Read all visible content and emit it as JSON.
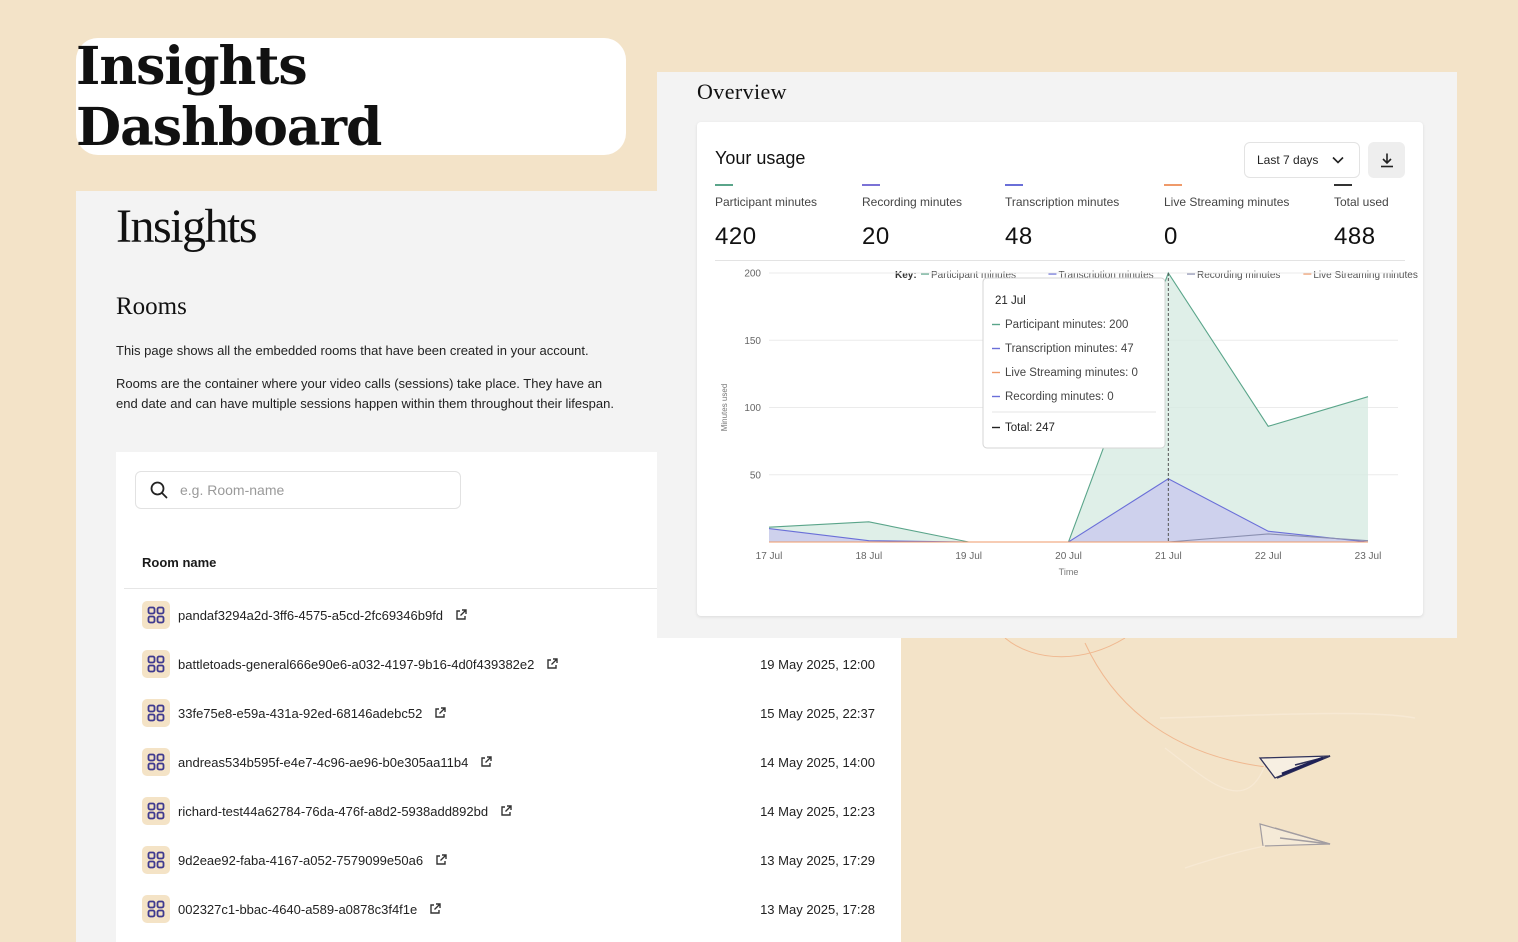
{
  "banner": {
    "title": "Insights Dashboard"
  },
  "rooms_page": {
    "logo": "Insights",
    "heading": "Rooms",
    "description1": "This page shows all the embedded rooms that have been created in your account.",
    "description2": "Rooms are the container where your video calls (sessions) take place. They have an end date and can have multiple sessions happen within them throughout their lifespan.",
    "search": {
      "placeholder": "e.g. Room-name"
    },
    "column_room_name": "Room name",
    "rooms": [
      {
        "name": "pandaf3294a2d-3ff6-4575-a5cd-2fc69346b9fd",
        "date": ""
      },
      {
        "name": "battletoads-general666e90e6-a032-4197-9b16-4d0f439382e2",
        "date": "19 May 2025, 12:00"
      },
      {
        "name": "33fe75e8-e59a-431a-92ed-68146adebc52",
        "date": "15 May 2025, 22:37"
      },
      {
        "name": "andreas534b595f-e4e7-4c96-ae96-b0e305aa11b4",
        "date": "14 May 2025, 14:00"
      },
      {
        "name": "richard-test44a62784-76da-476f-a8d2-5938add892bd",
        "date": "14 May 2025, 12:23"
      },
      {
        "name": "9d2eae92-faba-4167-a052-7579099e50a6",
        "date": "13 May 2025, 17:29"
      },
      {
        "name": "002327c1-bbac-4640-a589-a0878c3f4f1e",
        "date": "13 May 2025, 17:28"
      }
    ]
  },
  "overview": {
    "title": "Overview",
    "usage_title": "Your usage",
    "range_select": "Last 7 days",
    "stats": [
      {
        "label": "Participant minutes",
        "value": "420",
        "color": "#5aa58a"
      },
      {
        "label": "Recording minutes",
        "value": "20",
        "color": "#7b72d6"
      },
      {
        "label": "Transcription minutes",
        "value": "48",
        "color": "#6a6fd8"
      },
      {
        "label": "Live Streaming minutes",
        "value": "0",
        "color": "#ef9a6a"
      },
      {
        "label": "Total used",
        "value": "488",
        "color": "#333333"
      }
    ],
    "tooltip": {
      "date": "21 Jul",
      "lines": [
        "Participant minutes: 200",
        "Transcription minutes: 47",
        "Live Streaming minutes: 0",
        "Recording minutes: 0"
      ],
      "total": "Total: 247"
    }
  },
  "chart_data": {
    "type": "area",
    "key_label": "Key:",
    "x": [
      "17 Jul",
      "18 Jul",
      "19 Jul",
      "20 Jul",
      "21 Jul",
      "22 Jul",
      "23 Jul"
    ],
    "xlabel": "Time",
    "ylabel": "Minutes used",
    "ylim": [
      0,
      200
    ],
    "yticks": [
      50,
      100,
      150,
      200
    ],
    "grid": true,
    "legend": "top-right",
    "series": [
      {
        "name": "Participant minutes",
        "color": "#5aa58a",
        "fill": "#d7ebe2",
        "values": [
          11,
          15,
          0,
          0,
          200,
          86,
          108
        ]
      },
      {
        "name": "Transcription minutes",
        "color": "#6a6fd8",
        "fill": "#c9c9ee",
        "values": [
          10,
          1,
          0,
          0,
          47,
          8,
          0
        ]
      },
      {
        "name": "Recording minutes",
        "color": "#8a8fb0",
        "fill": "none",
        "values": [
          0,
          0,
          0,
          0,
          0,
          6,
          1
        ]
      },
      {
        "name": "Live Streaming minutes",
        "color": "#ef9a6a",
        "fill": "none",
        "values": [
          0,
          0,
          0,
          0,
          0,
          0,
          0
        ]
      }
    ]
  }
}
